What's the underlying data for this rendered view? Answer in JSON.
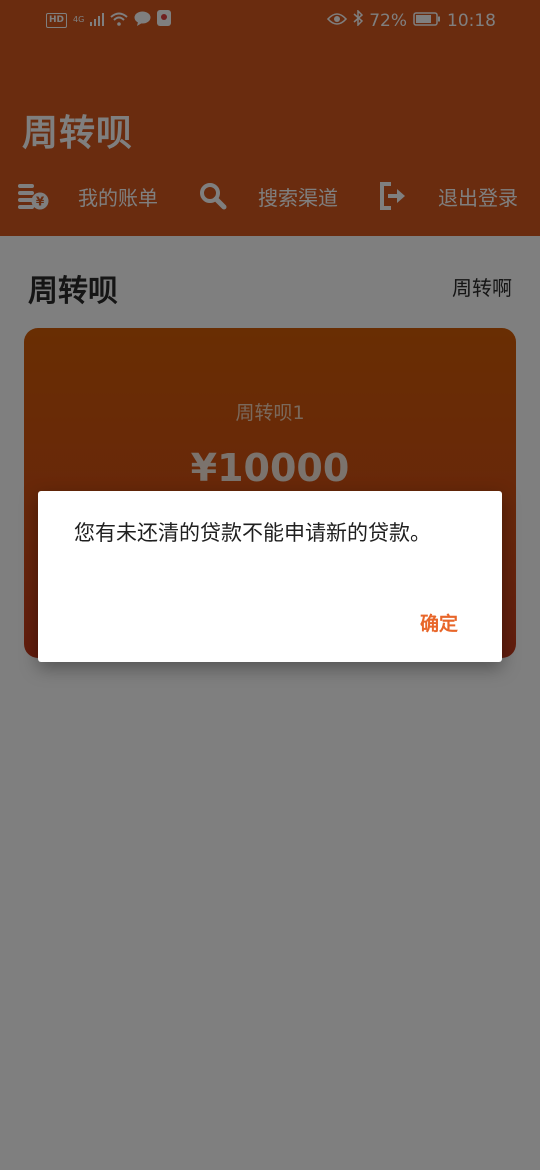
{
  "status_bar": {
    "hd": "HD",
    "network": "4G",
    "battery": "72%",
    "time": "10:18"
  },
  "app": {
    "title": "周转呗"
  },
  "nav": {
    "items": [
      {
        "label": "我的账单",
        "icon": "bill-coins-icon"
      },
      {
        "label": "搜索渠道",
        "icon": "search-icon"
      },
      {
        "label": "退出登录",
        "icon": "logout-icon"
      }
    ]
  },
  "content": {
    "title": "周转呗",
    "link": "周转啊"
  },
  "card": {
    "name": "周转呗1",
    "amount": "¥10000"
  },
  "dialog": {
    "message": "您有未还清的贷款不能申请新的贷款。",
    "confirm": "确定"
  },
  "colors": {
    "header": "#d5581f",
    "card_top": "#d35c06",
    "card_bottom": "#c43a1c",
    "accent": "#e8662a"
  }
}
